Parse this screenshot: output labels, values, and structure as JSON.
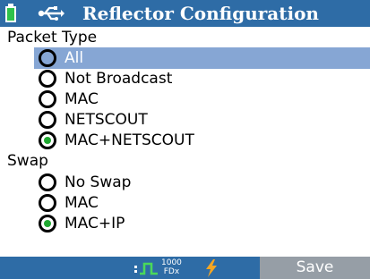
{
  "header": {
    "title": "Reflector Configuration",
    "icons": [
      "battery-icon",
      "usb-icon"
    ],
    "background": "#2e6ca6"
  },
  "packet_type": {
    "label": "Packet Type",
    "options": [
      {
        "label": "All",
        "checked": false,
        "highlighted": true
      },
      {
        "label": "Not Broadcast",
        "checked": false
      },
      {
        "label": "MAC",
        "checked": false
      },
      {
        "label": "NETSCOUT",
        "checked": false
      },
      {
        "label": "MAC+NETSCOUT",
        "checked": true
      }
    ]
  },
  "swap": {
    "label": "Swap",
    "options": [
      {
        "label": "No Swap",
        "checked": false
      },
      {
        "label": "MAC",
        "checked": false
      },
      {
        "label": "MAC+IP",
        "checked": true
      }
    ]
  },
  "statusbar": {
    "speed": "1000",
    "duplex": "FDx",
    "icons": [
      "link-icon",
      "lightning-icon"
    ],
    "save_label": "Save"
  },
  "colors": {
    "accent": "#2e6ca6",
    "highlight": "#86a6d4",
    "radio_checked": "#1fa830",
    "save_button": "#969ea6"
  }
}
